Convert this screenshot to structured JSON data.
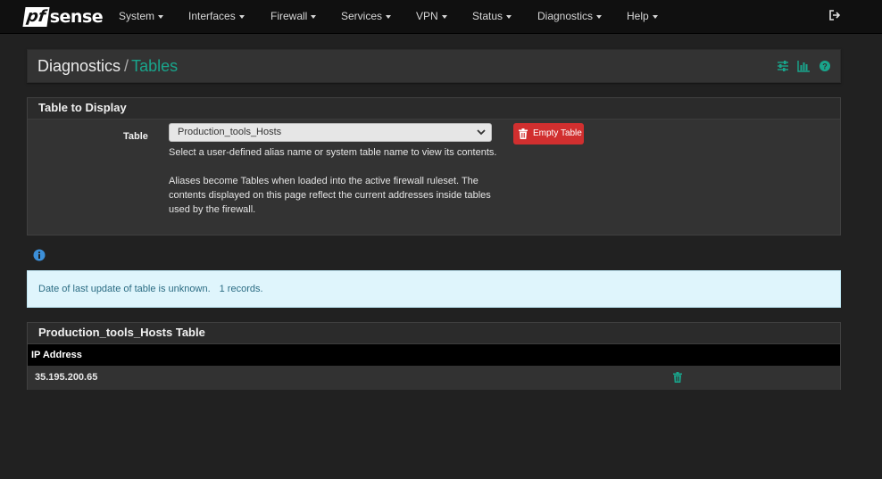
{
  "brand": {
    "logo_pf": "pf",
    "logo_sense": "sense"
  },
  "nav": {
    "items": [
      {
        "label": "System"
      },
      {
        "label": "Interfaces"
      },
      {
        "label": "Firewall"
      },
      {
        "label": "Services"
      },
      {
        "label": "VPN"
      },
      {
        "label": "Status"
      },
      {
        "label": "Diagnostics"
      },
      {
        "label": "Help"
      }
    ],
    "logout_icon": "sign-out-icon"
  },
  "breadcrumb": {
    "first": "Diagnostics",
    "separator": "/",
    "current": "Tables",
    "icons": [
      "sliders-icon",
      "bar-chart-icon",
      "help-circle-icon"
    ]
  },
  "table_panel": {
    "heading": "Table to Display",
    "field_label": "Table",
    "selected_table": "Production_tools_Hosts",
    "help_line1": "Select a user-defined alias name or system table name to view its contents.",
    "help_line2": "Aliases become Tables when loaded into the active firewall ruleset. The contents displayed on this page reflect the current addresses inside tables used by the firewall.",
    "empty_button": "Empty Table"
  },
  "alert": {
    "message": "Date of last update of table is unknown.",
    "records": "1 records."
  },
  "results_panel": {
    "heading": "Production_tools_Hosts Table",
    "column_header": "IP Address",
    "rows": [
      {
        "ip": "35.195.200.65"
      }
    ]
  },
  "colors": {
    "accent": "#19a58c",
    "danger": "#d12f2f",
    "info_bg": "#dff5fc",
    "background": "#212121"
  }
}
